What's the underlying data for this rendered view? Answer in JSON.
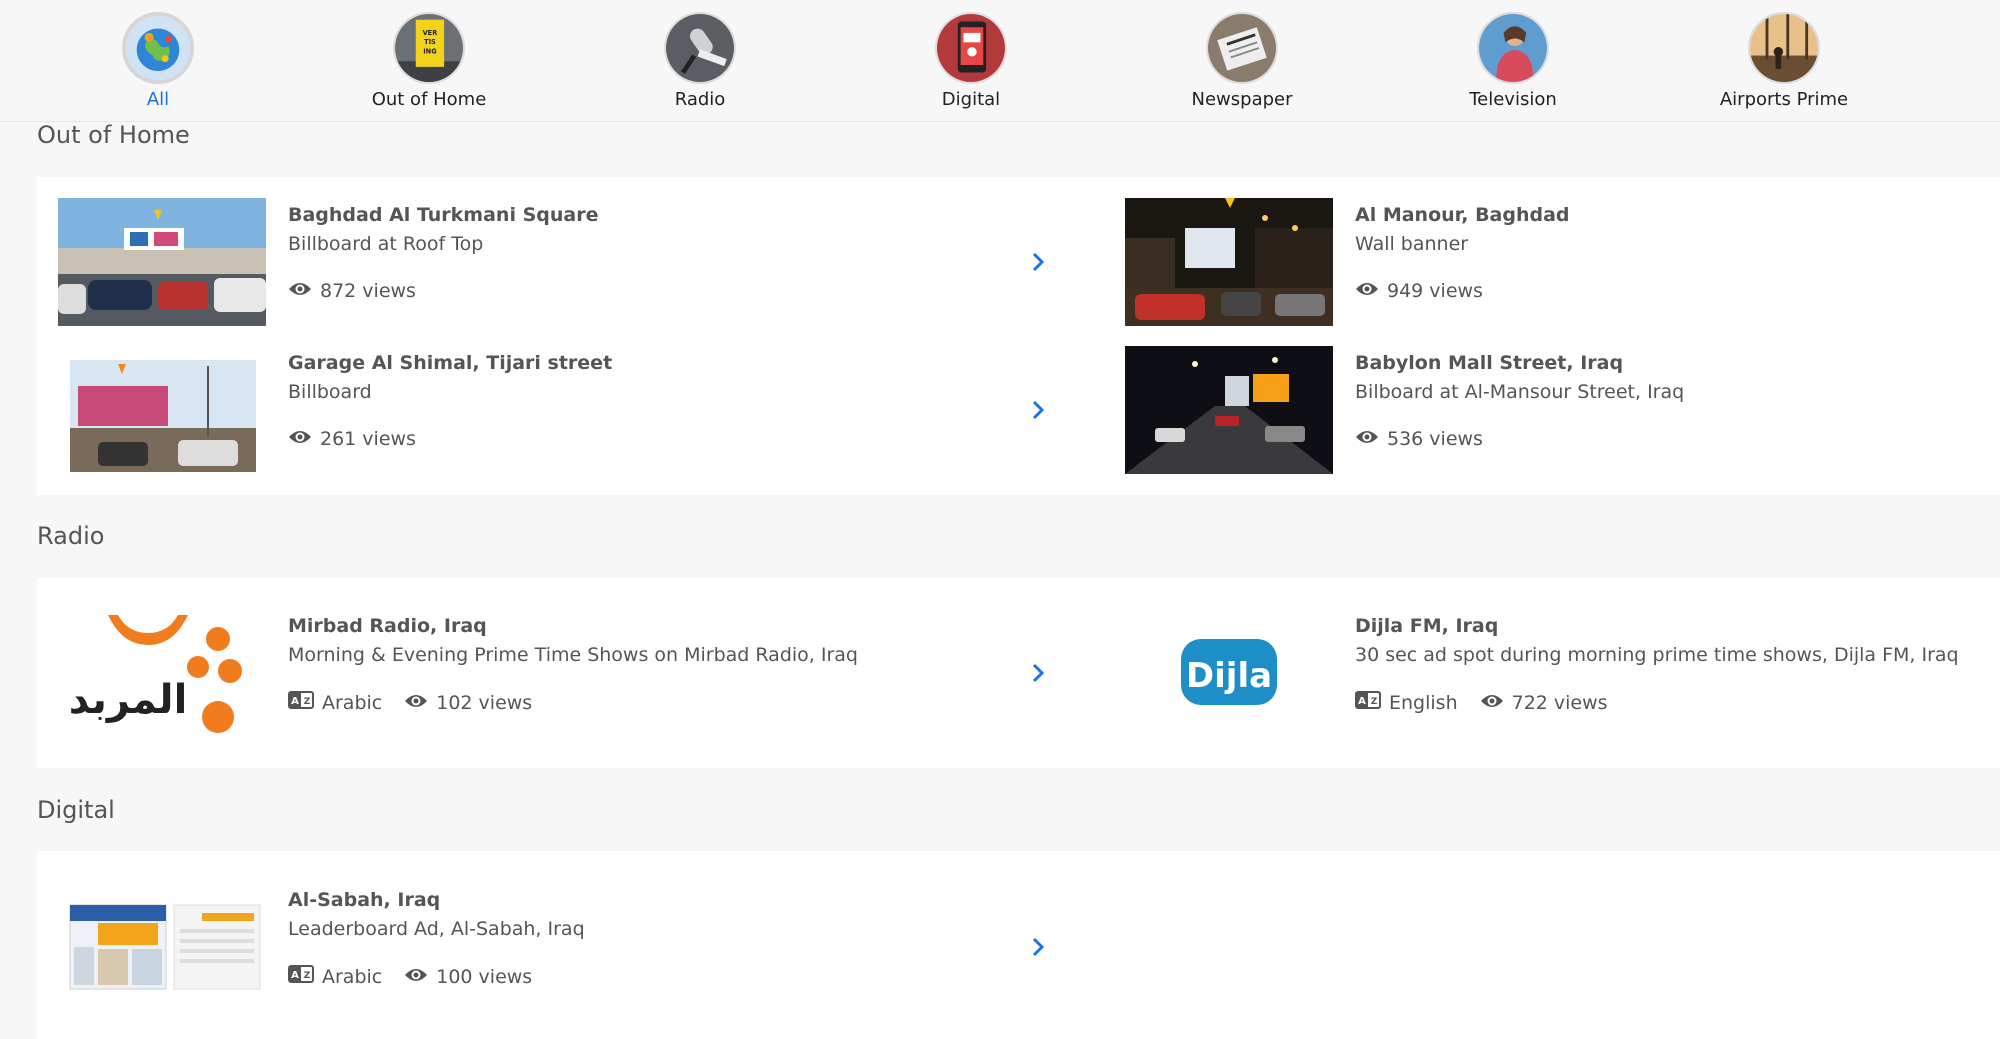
{
  "categories": [
    {
      "label": "All",
      "icon": "globe-icon",
      "active": true
    },
    {
      "label": "Out of Home",
      "icon": "billboard-icon"
    },
    {
      "label": "Radio",
      "icon": "microphone-icon"
    },
    {
      "label": "Digital",
      "icon": "smartphone-icon"
    },
    {
      "label": "Newspaper",
      "icon": "newspaper-icon"
    },
    {
      "label": "Television",
      "icon": "presenter-icon"
    },
    {
      "label": "Airports Prime",
      "icon": "airport-icon"
    }
  ],
  "sections": {
    "out_of_home": {
      "title": "Out of Home",
      "items": [
        {
          "title": "Baghdad Al Turkmani Square",
          "subtitle": "Billboard at Roof Top",
          "views": "872 views"
        },
        {
          "title": "Al Manour, Baghdad",
          "subtitle": "Wall banner",
          "views": "949 views"
        },
        {
          "title": "Garage Al Shimal, Tijari street",
          "subtitle": "Billboard",
          "views": "261 views"
        },
        {
          "title": "Babylon Mall Street, Iraq",
          "subtitle": "Bilboard at Al-Mansour Street, Iraq",
          "views": "536 views"
        }
      ]
    },
    "radio": {
      "title": "Radio",
      "items": [
        {
          "title": "Mirbad Radio, Iraq",
          "subtitle": "Morning & Evening Prime Time Shows on Mirbad Radio, Iraq",
          "language": "Arabic",
          "views": "102 views",
          "logo_text": "المربد"
        },
        {
          "title": "Dijla FM, Iraq",
          "subtitle": "30 sec ad spot during morning prime time shows, Dijla FM, Iraq",
          "language": "English",
          "views": "722 views",
          "logo_text": "Dijla"
        }
      ]
    },
    "digital": {
      "title": "Digital",
      "items": [
        {
          "title": "Al-Sabah, Iraq",
          "subtitle": "Leaderboard Ad, Al-Sabah, Iraq",
          "language": "Arabic",
          "views": "100 views"
        }
      ]
    }
  },
  "colors": {
    "accent": "#1a73e8",
    "mirbad_orange": "#f07c1e",
    "dijla_blue": "#1e8fc6"
  }
}
